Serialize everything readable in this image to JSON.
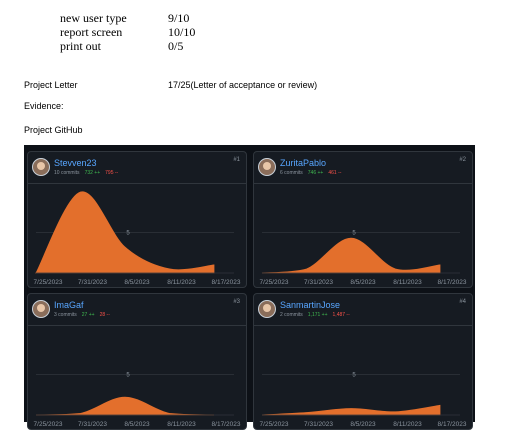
{
  "scores": [
    {
      "label": "new user type",
      "value": "9/10"
    },
    {
      "label": "report screen",
      "value": "10/10"
    },
    {
      "label": "print out",
      "value": "0/5"
    }
  ],
  "project_letter": {
    "label": "Project Letter",
    "value": "17/25(Letter of acceptance or review)"
  },
  "evidence": {
    "label": "Evidence:"
  },
  "project_github": {
    "label": "Project GitHub"
  },
  "contributors": [
    {
      "name": "Stevven23",
      "commits": "10 commits",
      "additions": "732 ++",
      "deletions": "795 --",
      "rank": "#1"
    },
    {
      "name": "ZuritaPablo",
      "commits": "6 commits",
      "additions": "746 ++",
      "deletions": "461 --",
      "rank": "#2"
    },
    {
      "name": "ImaGaf",
      "commits": "3 commits",
      "additions": "27 ++",
      "deletions": "28 --",
      "rank": "#3"
    },
    {
      "name": "SanmartinJose",
      "commits": "2 commits",
      "additions": "1,171 ++",
      "deletions": "1,487 --",
      "rank": "#4"
    }
  ],
  "chart_data": [
    {
      "type": "area",
      "x": [
        "7/25/2023",
        "7/31/2023",
        "8/5/2023",
        "8/11/2023",
        "8/17/2023"
      ],
      "ylim": [
        0,
        10
      ],
      "yticks": [
        "5"
      ],
      "series": [
        {
          "values": [
            0,
            10,
            3.2,
            0.5,
            1
          ]
        }
      ],
      "color": "#e36f2c"
    },
    {
      "type": "area",
      "x": [
        "7/25/2023",
        "7/31/2023",
        "8/5/2023",
        "8/11/2023",
        "8/17/2023"
      ],
      "ylim": [
        0,
        10
      ],
      "yticks": [
        "5"
      ],
      "series": [
        {
          "values": [
            0,
            0.5,
            4.3,
            0.5,
            1
          ]
        }
      ],
      "color": "#e36f2c"
    },
    {
      "type": "area",
      "x": [
        "7/25/2023",
        "7/31/2023",
        "8/5/2023",
        "8/11/2023",
        "8/17/2023"
      ],
      "ylim": [
        0,
        10
      ],
      "yticks": [
        "5"
      ],
      "series": [
        {
          "values": [
            0,
            0.2,
            2.2,
            0.2,
            0
          ]
        }
      ],
      "color": "#e36f2c"
    },
    {
      "type": "area",
      "x": [
        "7/25/2023",
        "7/31/2023",
        "8/5/2023",
        "8/11/2023",
        "8/17/2023"
      ],
      "ylim": [
        0,
        10
      ],
      "yticks": [
        "5"
      ],
      "series": [
        {
          "values": [
            0,
            0.3,
            0.8,
            0.4,
            1.2
          ]
        }
      ],
      "color": "#e36f2c"
    }
  ]
}
